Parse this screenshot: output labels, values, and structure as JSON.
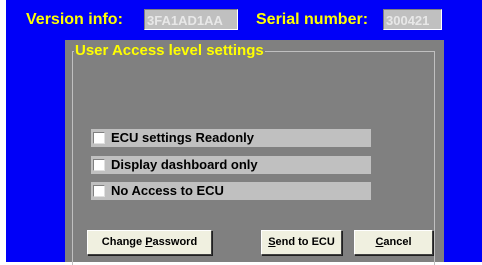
{
  "header": {
    "version_label": "Version info:",
    "version_value": "3FA1AD1AA",
    "serial_label": "Serial number:",
    "serial_value": "300421"
  },
  "group": {
    "title": "User Access level settings"
  },
  "options": [
    {
      "label": "ECU settings Readonly",
      "checked": false
    },
    {
      "label": "Display dashboard only",
      "checked": false
    },
    {
      "label": "No Access to ECU",
      "checked": false
    }
  ],
  "buttons": {
    "change_password": {
      "pre": "Change ",
      "accel": "P",
      "post": "assword"
    },
    "send_to_ecu": {
      "pre": "",
      "accel": "S",
      "post": "end to ECU"
    },
    "cancel": {
      "pre": "",
      "accel": "C",
      "post": "ancel"
    }
  },
  "colors": {
    "window_bg": "#0000f8",
    "accent_text": "#ffff00",
    "panel_bg": "#808080",
    "option_bg": "#c0c0c0",
    "button_bg": "#f0f0e0"
  }
}
